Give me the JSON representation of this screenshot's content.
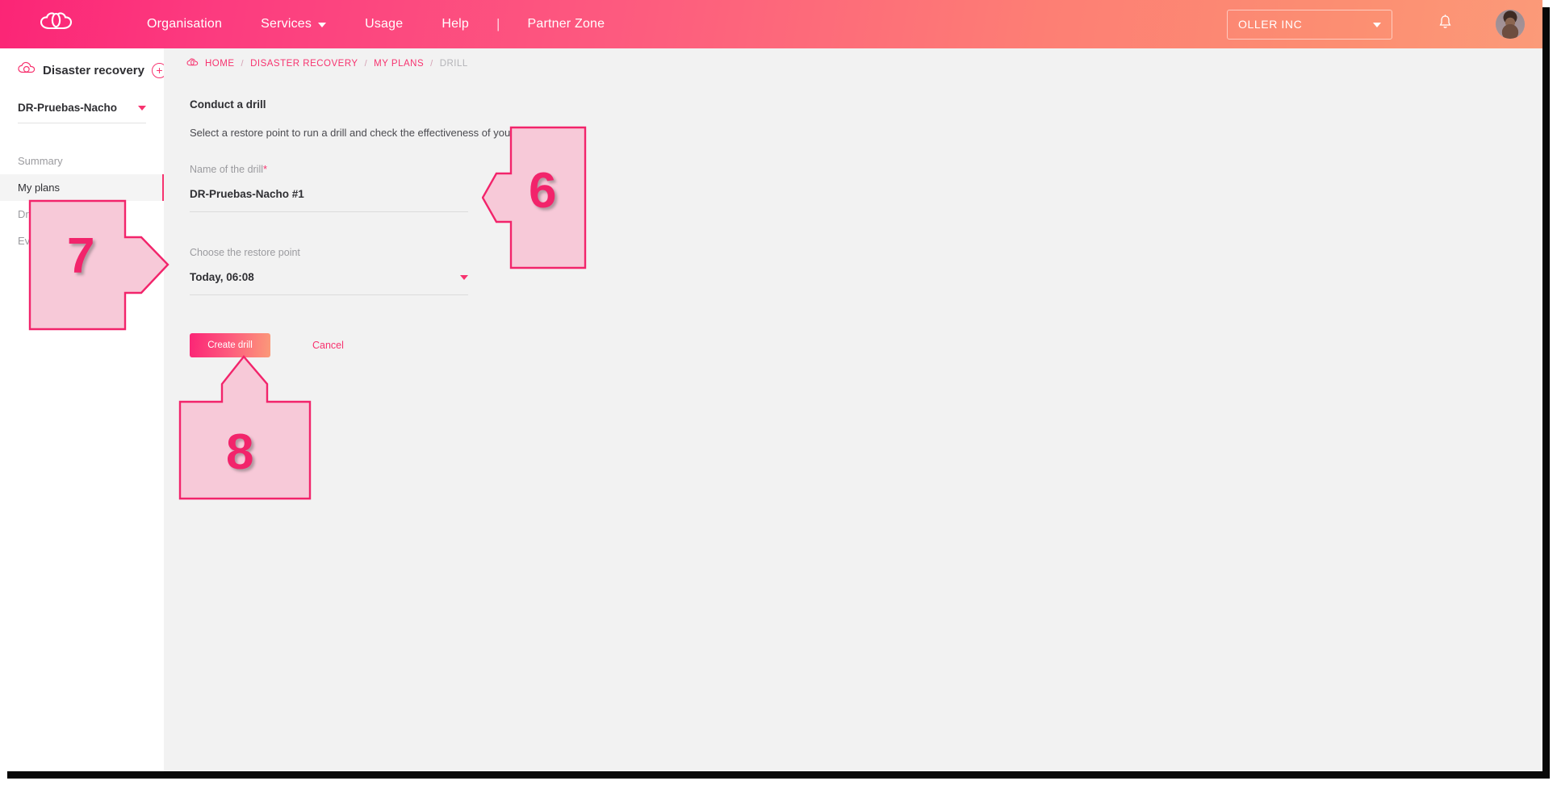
{
  "topbar": {
    "logo_icon": "cloud-logo-icon",
    "nav": [
      {
        "label": "Organisation",
        "has_caret": false
      },
      {
        "label": "Services",
        "has_caret": true
      },
      {
        "label": "Usage",
        "has_caret": false
      },
      {
        "label": "Help",
        "has_caret": false
      }
    ],
    "separator": "|",
    "partner_zone_label": "Partner Zone",
    "org_selector_value": "OLLER INC",
    "bell_icon": "notification-bell-icon",
    "avatar_icon": "user-avatar"
  },
  "sidebar": {
    "service_icon": "disaster-recovery-cloud-icon",
    "title": "Disaster recovery",
    "add_label": "+",
    "plan_selector_value": "DR-Pruebas-Nacho",
    "items": [
      {
        "label": "Summary",
        "active": false
      },
      {
        "label": "My plans",
        "active": true
      },
      {
        "label": "Drills",
        "active": false
      },
      {
        "label": "Events",
        "active": false
      }
    ]
  },
  "breadcrumb": {
    "home_icon": "cloud-home-icon",
    "items": [
      {
        "label": "HOME",
        "muted": false
      },
      {
        "label": "DISASTER RECOVERY",
        "muted": false
      },
      {
        "label": "MY PLANS",
        "muted": false
      },
      {
        "label": "DRILL",
        "muted": true
      }
    ],
    "separator": "/"
  },
  "main": {
    "section_title": "Conduct a drill",
    "section_subtitle": "Select a restore point to run a drill and check the effectiveness of your plan",
    "name_field": {
      "label": "Name of the drill",
      "required_marker": "*",
      "value": "DR-Pruebas-Nacho #1",
      "placeholder": "Name of the drill"
    },
    "restore_field": {
      "label": "Choose the restore point",
      "value": "Today, 06:08",
      "caret_icon": "chevron-down-icon"
    },
    "create_button_label": "Create drill",
    "cancel_button_label": "Cancel"
  },
  "annotations": [
    {
      "number": "6",
      "direction": "left"
    },
    {
      "number": "7",
      "direction": "right"
    },
    {
      "number": "8",
      "direction": "up"
    }
  ],
  "colors": {
    "brand_pink": "#f7336f",
    "brand_coral": "#fb9a79",
    "annotation_fill": "#f7c9d8",
    "annotation_stroke": "#f2246b",
    "annotation_number": "#f2246b"
  }
}
